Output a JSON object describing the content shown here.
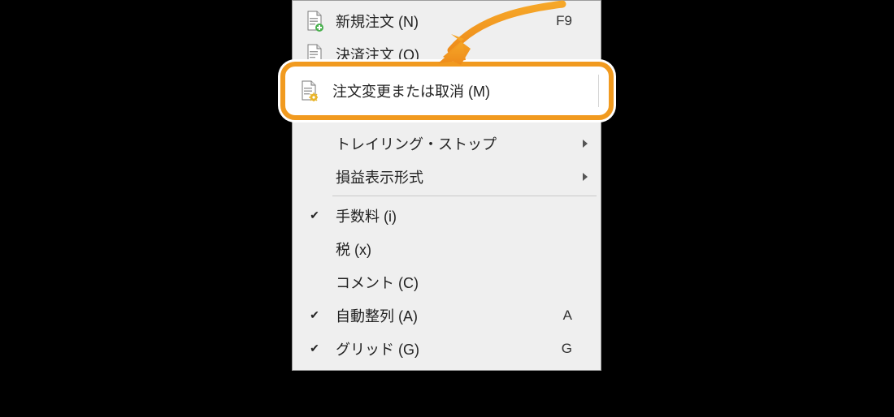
{
  "menu": {
    "items": [
      {
        "label": "新規注文 (N)",
        "accel": "F9",
        "icon": "doc-plus",
        "check": false,
        "submenu": false
      },
      {
        "label": "決済注文 (O)",
        "icon": "doc",
        "check": false,
        "submenu": false
      },
      {
        "label": "注文変更または取消 (M)",
        "icon": "doc-gear",
        "check": false,
        "submenu": false,
        "highlighted": true
      },
      {
        "label": "トレイリング・ストップ",
        "check": false,
        "submenu": true
      },
      {
        "label": "損益表示形式",
        "check": false,
        "submenu": true
      },
      {
        "label": "手数料 (i)",
        "check": true,
        "submenu": false
      },
      {
        "label": "税 (x)",
        "check": false,
        "submenu": false
      },
      {
        "label": "コメント (C)",
        "check": false,
        "submenu": false
      },
      {
        "label": "自動整列 (A)",
        "accel": "A",
        "check": true,
        "submenu": false
      },
      {
        "label": "グリッド (G)",
        "accel": "G",
        "check": true,
        "submenu": false
      }
    ],
    "separators_after": [
      1,
      4
    ]
  },
  "colors": {
    "highlight": "#F19A1F"
  }
}
